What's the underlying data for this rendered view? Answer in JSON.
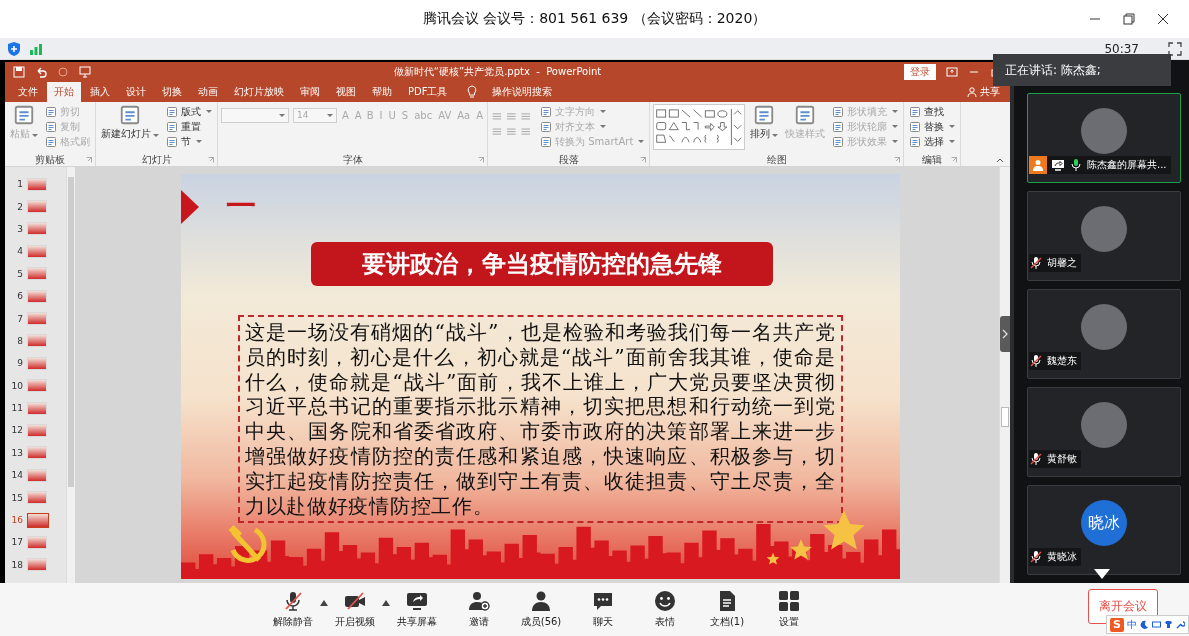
{
  "window": {
    "title": "腾讯会议 会议号：801 561 639 （会议密码：2020）"
  },
  "toolbar": {
    "timer": "50:37"
  },
  "speaking": {
    "label": "正在讲话: 陈杰鑫;"
  },
  "powerpoint": {
    "title": "做新时代“硬核”共产党员.pptx  -  PowerPoint",
    "login": "登录",
    "search": "操作说明搜索",
    "share": "共享",
    "tabs": [
      {
        "label": "文件",
        "selected": false
      },
      {
        "label": "开始",
        "selected": true
      },
      {
        "label": "插入",
        "selected": false
      },
      {
        "label": "设计",
        "selected": false
      },
      {
        "label": "切换",
        "selected": false
      },
      {
        "label": "动画",
        "selected": false
      },
      {
        "label": "幻灯片放映",
        "selected": false
      },
      {
        "label": "审阅",
        "selected": false
      },
      {
        "label": "视图",
        "selected": false
      },
      {
        "label": "帮助",
        "selected": false
      },
      {
        "label": "PDF工具",
        "selected": false
      }
    ],
    "ribbon": {
      "groups": [
        {
          "label": "剪贴板",
          "items": [
            {
              "kind": "large",
              "label": "粘贴",
              "disabled": true,
              "dropdown": true
            },
            {
              "kind": "small",
              "label": "剪切",
              "disabled": true
            },
            {
              "kind": "small",
              "label": "复制",
              "disabled": true
            },
            {
              "kind": "small",
              "label": "格式刷",
              "disabled": true
            }
          ]
        },
        {
          "label": "幻灯片",
          "items": [
            {
              "kind": "large",
              "label": "新建幻灯片",
              "disabled": false,
              "dropdown": true
            },
            {
              "kind": "small",
              "label": "版式",
              "disabled": false,
              "dropdown": true
            },
            {
              "kind": "small",
              "label": "重置",
              "disabled": false
            },
            {
              "kind": "small",
              "label": "节",
              "disabled": false,
              "dropdown": true
            }
          ]
        },
        {
          "label": "字体",
          "items": [
            {
              "kind": "font-fields",
              "size": "14",
              "glyphs": [
                "A",
                "A"
              ],
              "disabled": true
            },
            {
              "kind": "glyphs",
              "glyphs": [
                "B",
                "I",
                "U",
                "S",
                "abc",
                "AV",
                "Aa",
                "A"
              ],
              "disabled": true
            }
          ]
        },
        {
          "label": "段落",
          "items": [
            {
              "kind": "list-tools"
            },
            {
              "kind": "small",
              "label": "文字方向",
              "disabled": true,
              "dropdown": true
            },
            {
              "kind": "small",
              "label": "对齐文本",
              "disabled": true,
              "dropdown": true
            },
            {
              "kind": "small",
              "label": "转换为 SmartArt",
              "disabled": true,
              "dropdown": true
            }
          ]
        },
        {
          "label": "绘图",
          "items": [
            {
              "kind": "shape-gallery"
            },
            {
              "kind": "large",
              "label": "排列",
              "disabled": false,
              "dropdown": true
            },
            {
              "kind": "large",
              "label": "快速样式",
              "disabled": true,
              "dropdown": false
            },
            {
              "kind": "small",
              "label": "形状填充",
              "disabled": true,
              "dropdown": true
            },
            {
              "kind": "small",
              "label": "形状轮廓",
              "disabled": true,
              "dropdown": true
            },
            {
              "kind": "small",
              "label": "形状效果",
              "disabled": true,
              "dropdown": true
            }
          ]
        },
        {
          "label": "编辑",
          "items": [
            {
              "kind": "small",
              "label": "查找",
              "disabled": false
            },
            {
              "kind": "small",
              "label": "替换",
              "disabled": false,
              "dropdown": true
            },
            {
              "kind": "small",
              "label": "选择",
              "disabled": false,
              "dropdown": true
            }
          ]
        }
      ]
    },
    "thumbnails": [
      {
        "number": "1",
        "selected": false
      },
      {
        "number": "2",
        "selected": false
      },
      {
        "number": "3",
        "selected": false
      },
      {
        "number": "4",
        "selected": false
      },
      {
        "number": "5",
        "selected": false
      },
      {
        "number": "6",
        "selected": false
      },
      {
        "number": "7",
        "selected": false
      },
      {
        "number": "8",
        "selected": false
      },
      {
        "number": "9",
        "selected": false
      },
      {
        "number": "10",
        "selected": false
      },
      {
        "number": "11",
        "selected": false
      },
      {
        "number": "12",
        "selected": false
      },
      {
        "number": "13",
        "selected": false
      },
      {
        "number": "14",
        "selected": false
      },
      {
        "number": "15",
        "selected": false
      },
      {
        "number": "16",
        "selected": true
      },
      {
        "number": "17",
        "selected": false
      },
      {
        "number": "18",
        "selected": false
      }
    ],
    "slide": {
      "heading": "一",
      "title": "要讲政治，争当疫情防控的急先锋",
      "body": "这是一场没有硝烟的“战斗”，也是检验和考验我们每一名共产党员的时刻，初心是什么，初心就是“战斗”面前舍我其谁，使命是什么，使命就是“战斗”面前，我不上谁上，广大党员要坚决贯彻习近平总书记的重要指示批示精神，切实把思想和行动统一到党中央、国务院和省委省政府、市委市政府的决策部署上来进一步增强做好疫情防控的责任感和紧迫感，快速响应、积极参与，切实扛起疫情防控责任，做到守土有责、收徒担责、守土尽责，全力以赴做好疫情防控工作。"
    }
  },
  "participants": [
    {
      "name": "陈杰鑫的屏幕共...",
      "kind": "sharer",
      "speaking": true,
      "muted": false,
      "avatar": {
        "kind": "photo"
      }
    },
    {
      "name": "胡馨之",
      "kind": "member",
      "speaking": false,
      "muted": true,
      "avatar": {
        "kind": "photo"
      }
    },
    {
      "name": "魏楚东",
      "kind": "member",
      "speaking": false,
      "muted": true,
      "avatar": {
        "kind": "photo"
      }
    },
    {
      "name": "黄舒敏",
      "kind": "member",
      "speaking": false,
      "muted": true,
      "avatar": {
        "kind": "photo"
      }
    },
    {
      "name": "黄晓冰",
      "kind": "member",
      "speaking": false,
      "muted": true,
      "avatar": {
        "kind": "text",
        "text": "晓冰"
      }
    }
  ],
  "controls": [
    {
      "kind": "mic",
      "label": "解除静音",
      "off": true,
      "caret": true
    },
    {
      "kind": "camera",
      "label": "开启视频",
      "off": true,
      "caret": true
    },
    {
      "kind": "share",
      "label": "共享屏幕"
    },
    {
      "kind": "invite",
      "label": "邀请"
    },
    {
      "kind": "members",
      "label": "成员(56)"
    },
    {
      "kind": "chat",
      "label": "聊天"
    },
    {
      "kind": "emoji",
      "label": "表情"
    },
    {
      "kind": "docs",
      "label": "文档(1)"
    },
    {
      "kind": "settings",
      "label": "设置"
    }
  ],
  "leave": {
    "label": "离开会议"
  },
  "ime": {
    "logo": "S",
    "mode": "中"
  }
}
